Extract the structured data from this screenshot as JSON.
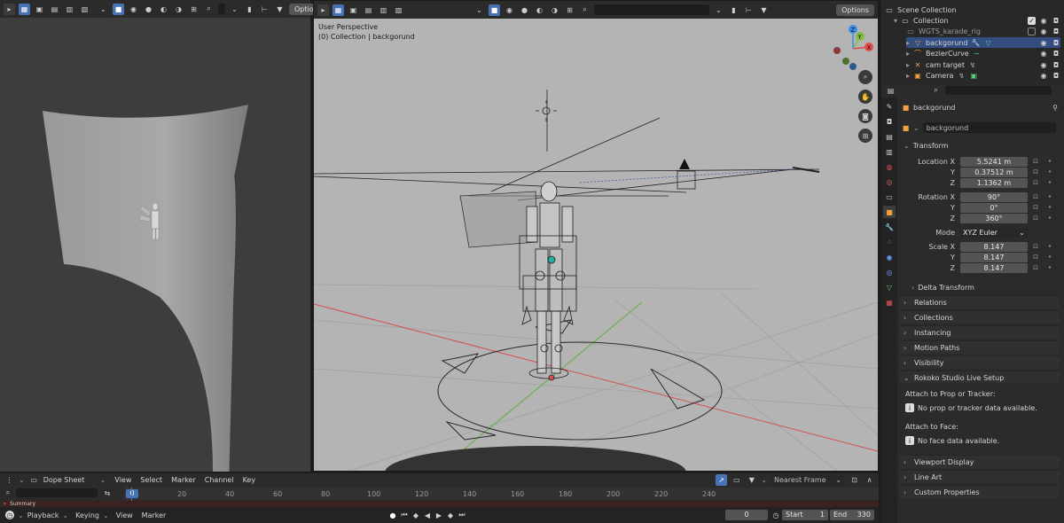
{
  "left_viewport": {
    "header": {
      "options_label": "Option"
    }
  },
  "main_viewport": {
    "header": {
      "options_label": "Options"
    },
    "overlay": {
      "view_name": "User Perspective",
      "context": "(0) Collection | backgorund"
    },
    "gizmo": {
      "x": "X",
      "y": "Y",
      "z": "Z"
    }
  },
  "outliner": {
    "scene_collection": "Scene Collection",
    "items": [
      {
        "label": "Collection"
      },
      {
        "label": "WGTS_karade_rig"
      },
      {
        "label": "backgorund"
      },
      {
        "label": "BezierCurve"
      },
      {
        "label": "cam target"
      },
      {
        "label": "Camera"
      }
    ]
  },
  "properties": {
    "object_name": "backgorund",
    "data_name": "backgorund",
    "transform": {
      "title": "Transform",
      "location_label": "Location X",
      "location": [
        "5.5241 m",
        "0.37512 m",
        "1.1362 m"
      ],
      "rotation_label": "Rotation X",
      "rotation": [
        "90°",
        "0°",
        "360°"
      ],
      "mode_label": "Mode",
      "mode_value": "XYZ Euler",
      "scale_label": "Scale X",
      "scale": [
        "8.147",
        "8.147",
        "8.147"
      ],
      "y": "Y",
      "z": "Z",
      "delta": "Delta Transform"
    },
    "panels": {
      "relations": "Relations",
      "collections": "Collections",
      "instancing": "Instancing",
      "motion_paths": "Motion Paths",
      "visibility": "Visibility",
      "rokoko": "Rokoko Studio Live Setup",
      "viewport_display": "Viewport Display",
      "line_art": "Line Art",
      "custom_properties": "Custom Properties"
    },
    "rokoko": {
      "prop_label": "Attach to Prop or Tracker:",
      "prop_info": "No prop or tracker data available.",
      "face_label": "Attach to Face:",
      "face_info": "No face data available."
    }
  },
  "dope_sheet": {
    "editor": "Dope Sheet",
    "menu": [
      "View",
      "Select",
      "Marker",
      "Channel",
      "Key"
    ],
    "snap": "Nearest Frame",
    "current_frame_marker": "0",
    "ticks": [
      "20",
      "40",
      "60",
      "80",
      "100",
      "120",
      "140",
      "160",
      "180",
      "200",
      "220",
      "240"
    ],
    "summary": "Summary"
  },
  "playback": {
    "playback": "Playback",
    "keying": "Keying",
    "view": "View",
    "marker": "Marker",
    "current_frame": "0",
    "start_label": "Start",
    "start": "1",
    "end_label": "End",
    "end": "330"
  },
  "colors": {
    "accent": "#4772b3",
    "x_axis": "#e34b4b",
    "y_axis": "#7fbf3f",
    "z_axis": "#3a8ee6"
  }
}
